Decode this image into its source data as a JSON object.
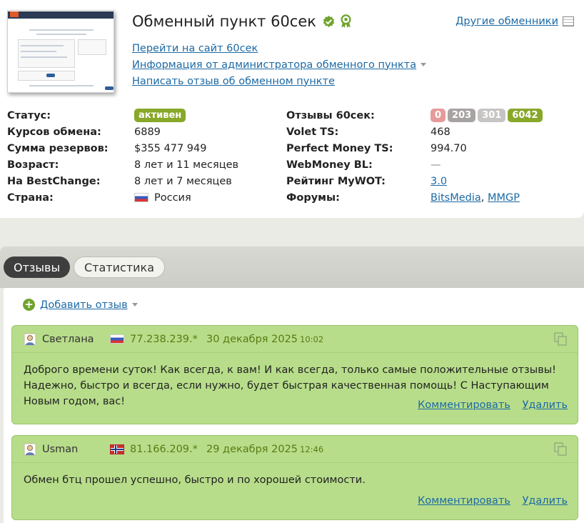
{
  "header": {
    "title": "Обменный пункт 60сек",
    "links": [
      "Перейти на сайт 60сек",
      "Информация от администратора обменного пункта",
      "Написать отзыв об обменном пункте"
    ],
    "other_exchangers": "Другие обменники"
  },
  "info": {
    "left": [
      {
        "label": "Статус:",
        "value": "активен"
      },
      {
        "label": "Курсов обмена:",
        "value": "6889"
      },
      {
        "label": "Сумма резервов:",
        "value": "$355 477 949"
      },
      {
        "label": "Возраст:",
        "value": "8 лет и 11 месяцев"
      },
      {
        "label": "На BestChange:",
        "value": "8 лет и 7 месяцев"
      },
      {
        "label": "Страна:",
        "value": "Россия"
      }
    ],
    "right": [
      {
        "label": "Отзывы 60сек:",
        "counts": [
          "0",
          "203",
          "301",
          "6042"
        ]
      },
      {
        "label": "Volet TS:",
        "value": "468"
      },
      {
        "label": "Perfect Money TS:",
        "value": "994.70"
      },
      {
        "label": "WebMoney BL:",
        "value": "—"
      },
      {
        "label": "Рейтинг MyWOT:",
        "value": "3.0"
      },
      {
        "label": "Форумы:",
        "forums": [
          "BitsMedia",
          "MMGP"
        ]
      }
    ]
  },
  "tabs": [
    "Отзывы",
    "Статистика"
  ],
  "add_review": "Добавить отзыв",
  "reviews": [
    {
      "user": "Светлана",
      "ip": "77.238.239.*",
      "date": "30 декабря 2025",
      "time": "10:02",
      "text": "Доброго времени суток! Как всегда, к вам! И как всегда, только самые положительные отзывы! Надежно, быстро и всегда, если нужно, будет быстрая качественная помощь! С Наступающим Новым годом, вас!",
      "comment": "Комментировать",
      "delete": "Удалить"
    },
    {
      "user": "Usman",
      "ip": "81.166.209.*",
      "date": "29 декабря 2025",
      "time": "12:46",
      "text": "Обмен бтц прошел успешно, быстро и по хорошей стоимости.",
      "comment": "Комментировать",
      "delete": "Удалить"
    }
  ],
  "colors": {
    "accent_green": "#88a82a",
    "link": "#1d6aa5",
    "review_bg": "#b7dd8a"
  },
  "icons": [
    "verified-icon",
    "award-icon",
    "table-icon",
    "plus-icon",
    "user-icon",
    "copy-icon",
    "caret-down-icon",
    "flag-russia-icon",
    "flag-norway-icon"
  ]
}
